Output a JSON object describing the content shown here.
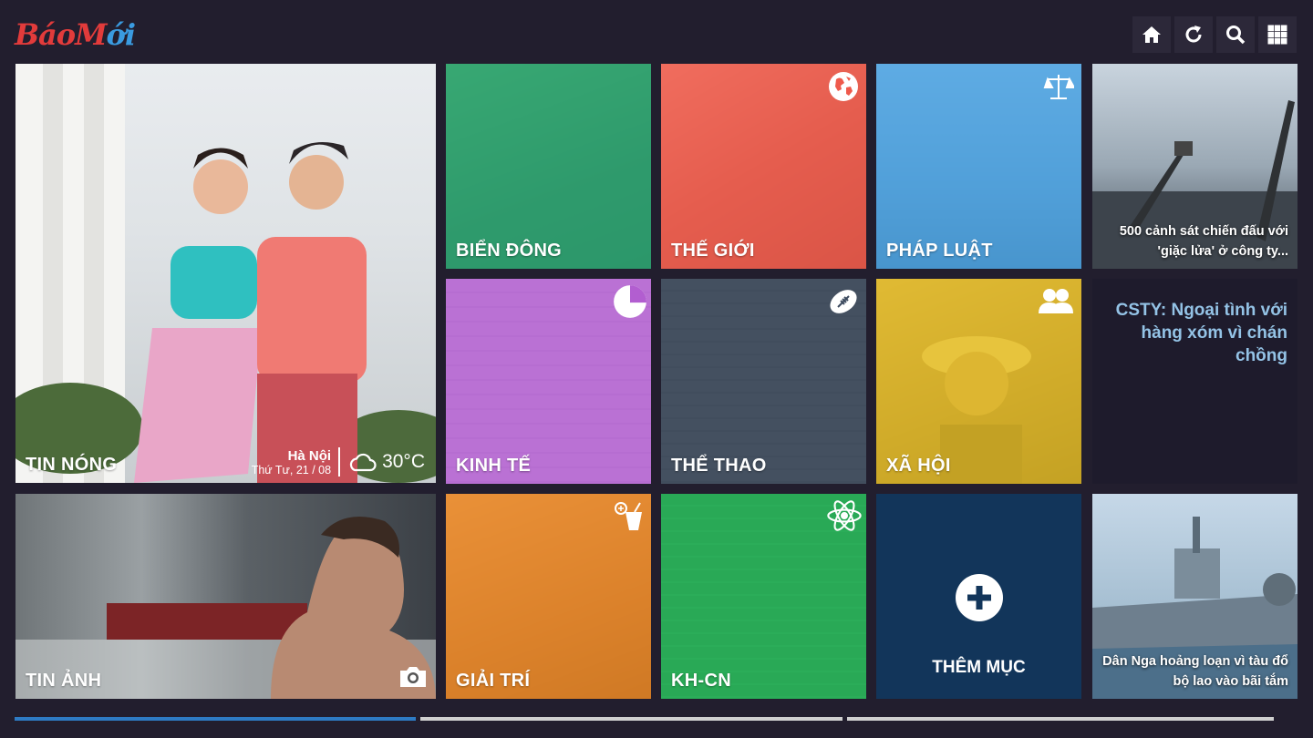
{
  "app": {
    "logo_part1": "Báo",
    "logo_part2": "M",
    "logo_part3": "ới"
  },
  "toolbar": {
    "buttons": [
      {
        "name": "home-button",
        "icon": "home-icon"
      },
      {
        "name": "refresh-button",
        "icon": "refresh-icon"
      },
      {
        "name": "search-button",
        "icon": "search-icon"
      },
      {
        "name": "apps-button",
        "icon": "grid-icon"
      }
    ]
  },
  "tiles": {
    "tin_nong": {
      "label": "TIN NÓNG",
      "city": "Hà Nội",
      "date": "Thứ Tư, 21 / 08",
      "temperature": "30°C"
    },
    "bien_dong": {
      "label": "BIỂN ĐÔNG",
      "color": "#2fb37d"
    },
    "the_gioi": {
      "label": "THẾ GIỚI",
      "color": "#ef5a4c",
      "icon": "globe-icon"
    },
    "phap_luat": {
      "label": "PHÁP LUẬT",
      "color": "#4aa4e4",
      "icon": "scales-icon"
    },
    "news_fire": {
      "caption": "500 cảnh sát chiến đấu với 'giặc lửa' ở công ty..."
    },
    "kinh_te": {
      "label": "KINH TẾ",
      "color": "#b25ed0",
      "icon": "pie-chart-icon"
    },
    "the_thao": {
      "label": "THỂ THAO",
      "color": "#3c4a5e",
      "icon": "football-icon"
    },
    "xa_hoi": {
      "label": "XÃ HỘI",
      "color": "#e6bf26",
      "icon": "people-icon"
    },
    "csty": {
      "headline": "CSTY: Ngoại tình với hàng xóm vì chán chồng"
    },
    "tin_anh": {
      "label": "TIN ẢNH",
      "icon": "camera-icon"
    },
    "giai_tri": {
      "label": "GIẢI TRÍ",
      "color": "#f08b26",
      "icon": "drink-icon"
    },
    "kh_cn": {
      "label": "KH-CN",
      "color": "#2cb65c",
      "icon": "atom-icon"
    },
    "them_muc": {
      "label": "THÊM MỤC"
    },
    "news_ship": {
      "caption": "Dân Nga hoảng loạn vì tàu đổ bộ lao vào bãi tắm"
    }
  },
  "pager": {
    "active_color": "#2e7bc4",
    "inactive_color": "#d0d0d0"
  }
}
